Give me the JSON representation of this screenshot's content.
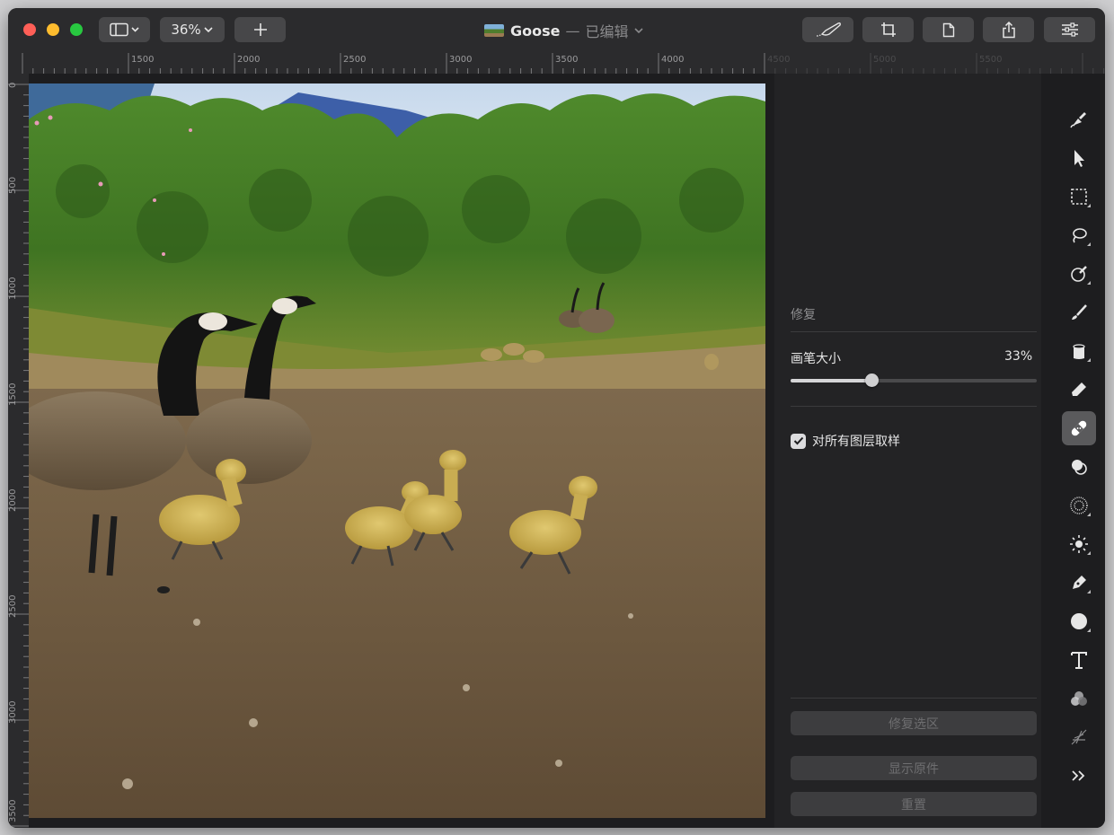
{
  "window": {
    "zoom_label": "36%",
    "document": {
      "name": "Goose",
      "separator": "—",
      "status": "已编辑"
    }
  },
  "rulers": {
    "top": [
      "1500",
      "2000",
      "2500",
      "3000",
      "3500",
      "4000",
      "4500",
      "5000",
      "5500"
    ],
    "left": [
      "0",
      "500",
      "1000",
      "1500",
      "2000",
      "2500",
      "3000",
      "3500"
    ]
  },
  "inspector": {
    "section_title": "修复",
    "brush_size": {
      "label": "画笔大小",
      "value_text": "33%",
      "value": 0.33
    },
    "sample_all_layers": {
      "label": "对所有图层取样",
      "checked": true
    },
    "buttons": {
      "repair_selection": "修复选区",
      "show_original": "显示原件",
      "reset": "重置"
    }
  },
  "tools": [
    "paint-select-icon",
    "arrow-pointer-icon",
    "rect-select-icon",
    "lasso-icon",
    "magic-brush-icon",
    "paintbrush-icon",
    "paint-bucket-icon",
    "eraser-icon",
    "repair-bandage-icon",
    "clone-icon",
    "blur-icon",
    "brightness-icon",
    "pen-nib-icon",
    "circle-shape-icon",
    "text-icon",
    "color-adjust-icon",
    "sparkle-icon",
    "chevrons-right-icon"
  ],
  "colors": {
    "window_bg": "#1d1d1f",
    "panel_bg": "#232325",
    "active_tool": "#5a5a5c"
  }
}
